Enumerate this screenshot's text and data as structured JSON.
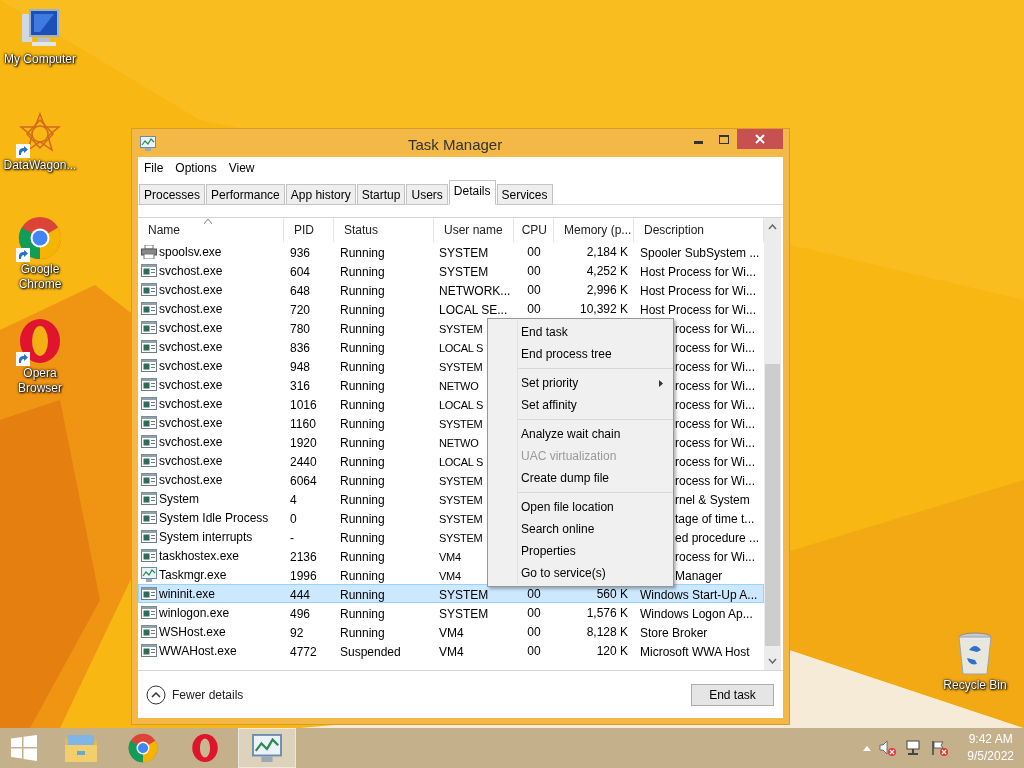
{
  "desktop_icons": [
    {
      "label": "My Computer",
      "kind": "computer",
      "shortcut": false
    },
    {
      "label": "DataWagon...",
      "kind": "star",
      "shortcut": true
    },
    {
      "label": "Google Chrome",
      "kind": "chrome",
      "shortcut": true
    },
    {
      "label": "Opera Browser",
      "kind": "opera",
      "shortcut": true
    },
    {
      "label": "Recycle Bin",
      "kind": "bin",
      "shortcut": false
    }
  ],
  "window": {
    "title": "Task Manager",
    "menu": [
      "File",
      "Options",
      "View"
    ],
    "tabs": [
      {
        "label": "Processes",
        "selected": false
      },
      {
        "label": "Performance",
        "selected": false
      },
      {
        "label": "App history",
        "selected": false
      },
      {
        "label": "Startup",
        "selected": false
      },
      {
        "label": "Users",
        "selected": false
      },
      {
        "label": "Details",
        "selected": true
      },
      {
        "label": "Services",
        "selected": false
      }
    ],
    "table": {
      "columns": [
        {
          "label": "Name",
          "sorted": true
        },
        {
          "label": "PID",
          "sorted": false
        },
        {
          "label": "Status",
          "sorted": false
        },
        {
          "label": "User name",
          "sorted": false
        },
        {
          "label": "CPU",
          "sorted": false
        },
        {
          "label": "Memory (p...",
          "sorted": false
        },
        {
          "label": "Description",
          "sorted": false
        }
      ],
      "rows": [
        {
          "kind": "printer",
          "name": "spoolsv.exe",
          "pid": "936",
          "status": "Running",
          "user": "SYSTEM",
          "cpu": "00",
          "memory": "2,184 K",
          "description": "Spooler SubSystem ...",
          "selected": false
        },
        {
          "kind": "service",
          "name": "svchost.exe",
          "pid": "604",
          "status": "Running",
          "user": "SYSTEM",
          "cpu": "00",
          "memory": "4,252 K",
          "description": "Host Process for Wi...",
          "selected": false
        },
        {
          "kind": "service",
          "name": "svchost.exe",
          "pid": "648",
          "status": "Running",
          "user": "NETWORK...",
          "cpu": "00",
          "memory": "2,996 K",
          "description": "Host Process for Wi...",
          "selected": false
        },
        {
          "kind": "service",
          "name": "svchost.exe",
          "pid": "720",
          "status": "Running",
          "user": "LOCAL SE...",
          "cpu": "00",
          "memory": "10,392 K",
          "description": "Host Process for Wi...",
          "selected": false
        },
        {
          "kind": "service",
          "name": "svchost.exe",
          "pid": "780",
          "status": "Running",
          "user": "SYSTEM",
          "description": "rocess for Wi...",
          "selected": false
        },
        {
          "kind": "service",
          "name": "svchost.exe",
          "pid": "836",
          "status": "Running",
          "user": "LOCAL S",
          "description": "rocess for Wi...",
          "selected": false
        },
        {
          "kind": "service",
          "name": "svchost.exe",
          "pid": "948",
          "status": "Running",
          "user": "SYSTEM",
          "description": "rocess for Wi...",
          "selected": false
        },
        {
          "kind": "service",
          "name": "svchost.exe",
          "pid": "316",
          "status": "Running",
          "user": "NETWO",
          "description": "rocess for Wi...",
          "selected": false
        },
        {
          "kind": "service",
          "name": "svchost.exe",
          "pid": "1016",
          "status": "Running",
          "user": "LOCAL S",
          "description": "rocess for Wi...",
          "selected": false
        },
        {
          "kind": "service",
          "name": "svchost.exe",
          "pid": "1160",
          "status": "Running",
          "user": "SYSTEM",
          "description": "rocess for Wi...",
          "selected": false
        },
        {
          "kind": "service",
          "name": "svchost.exe",
          "pid": "1920",
          "status": "Running",
          "user": "NETWO",
          "description": "rocess for Wi...",
          "selected": false
        },
        {
          "kind": "service",
          "name": "svchost.exe",
          "pid": "2440",
          "status": "Running",
          "user": "LOCAL S",
          "description": "rocess for Wi...",
          "selected": false
        },
        {
          "kind": "service",
          "name": "svchost.exe",
          "pid": "6064",
          "status": "Running",
          "user": "SYSTEM",
          "description": "rocess for Wi...",
          "selected": false
        },
        {
          "kind": "service",
          "name": "System",
          "pid": "4",
          "status": "Running",
          "user": "SYSTEM",
          "description": "rnel & System",
          "selected": false
        },
        {
          "kind": "service",
          "name": "System Idle Process",
          "pid": "0",
          "status": "Running",
          "user": "SYSTEM",
          "description": "tage of time t...",
          "selected": false
        },
        {
          "kind": "service",
          "name": "System interrupts",
          "pid": "-",
          "status": "Running",
          "user": "SYSTEM",
          "description": "ed procedure ...",
          "selected": false
        },
        {
          "kind": "service",
          "name": "taskhostex.exe",
          "pid": "2136",
          "status": "Running",
          "user": "VM4",
          "description": "rocess for Wi...",
          "selected": false
        },
        {
          "kind": "monitor",
          "name": "Taskmgr.exe",
          "pid": "1996",
          "status": "Running",
          "user": "VM4",
          "description": "Manager",
          "selected": false
        },
        {
          "kind": "service",
          "name": "wininit.exe",
          "pid": "444",
          "status": "Running",
          "user": "SYSTEM",
          "cpu": "00",
          "memory": "560 K",
          "description": "Windows Start-Up A...",
          "selected": true
        },
        {
          "kind": "service",
          "name": "winlogon.exe",
          "pid": "496",
          "status": "Running",
          "user": "SYSTEM",
          "cpu": "00",
          "memory": "1,576 K",
          "description": "Windows Logon Ap...",
          "selected": false
        },
        {
          "kind": "service",
          "name": "WSHost.exe",
          "pid": "92",
          "status": "Running",
          "user": "VM4",
          "cpu": "00",
          "memory": "8,128 K",
          "description": "Store Broker",
          "selected": false
        },
        {
          "kind": "service",
          "name": "WWAHost.exe",
          "pid": "4772",
          "status": "Suspended",
          "user": "VM4",
          "cpu": "00",
          "memory": "120 K",
          "description": "Microsoft WWA Host",
          "selected": false
        }
      ]
    },
    "fewer_details": "Fewer details",
    "end_task_button": "End task"
  },
  "context_menu": {
    "groups": [
      [
        {
          "label": "End task",
          "disabled": false,
          "submenu": false
        },
        {
          "label": "End process tree",
          "disabled": false,
          "submenu": false
        }
      ],
      [
        {
          "label": "Set priority",
          "disabled": false,
          "submenu": true
        },
        {
          "label": "Set affinity",
          "disabled": false,
          "submenu": false
        }
      ],
      [
        {
          "label": "Analyze wait chain",
          "disabled": false,
          "submenu": false
        },
        {
          "label": "UAC virtualization",
          "disabled": true,
          "submenu": false
        },
        {
          "label": "Create dump file",
          "disabled": false,
          "submenu": false
        }
      ],
      [
        {
          "label": "Open file location",
          "disabled": false,
          "submenu": false
        },
        {
          "label": "Search online",
          "disabled": false,
          "submenu": false
        },
        {
          "label": "Properties",
          "disabled": false,
          "submenu": false
        },
        {
          "label": "Go to service(s)",
          "disabled": false,
          "submenu": false
        }
      ]
    ]
  },
  "taskbar": {
    "apps": [
      {
        "kind": "explorer",
        "active": false
      },
      {
        "kind": "chrome",
        "active": false
      },
      {
        "kind": "opera",
        "active": false
      },
      {
        "kind": "monitor",
        "active": true
      }
    ],
    "tray": [
      {
        "kind": "volume",
        "error": true
      },
      {
        "kind": "network",
        "error": false
      },
      {
        "kind": "flag",
        "error": true
      }
    ],
    "time": "9:42 AM",
    "date": "9/5/2022"
  }
}
